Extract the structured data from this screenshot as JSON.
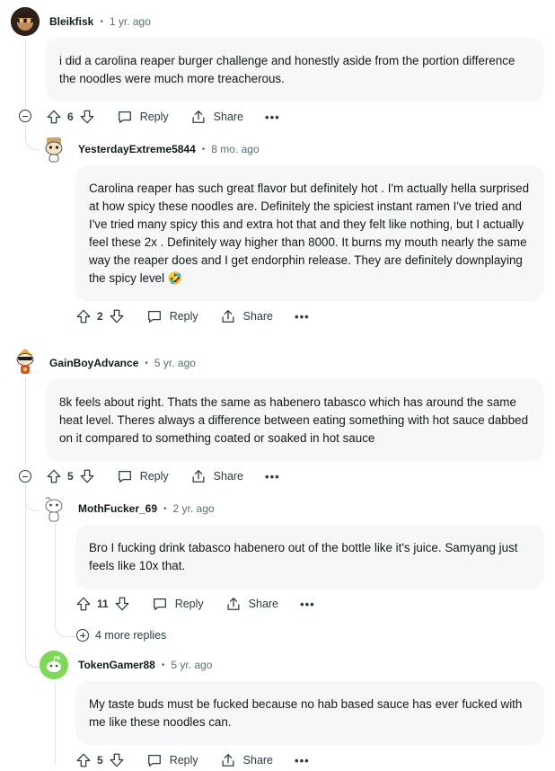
{
  "comments": [
    {
      "user": "Bleikfisk",
      "time": "1 yr. ago",
      "avatar": "dark-photo-avatar",
      "text": "i did a carolina reaper burger challenge and honestly aside from the portion difference the noodles were much more treacherous.",
      "votes": "6",
      "reply_label": "Reply",
      "share_label": "Share"
    },
    {
      "user": "YesterdayExtreme5844",
      "time": "8 mo. ago",
      "avatar": "snoo-cartoon-avatar",
      "text": "Carolina reaper has such great flavor but definitely hot . I'm actually hella surprised at how spicy these noodles are. Definitely the spiciest instant ramen I've tried and I've tried many spicy this and extra hot that and they felt like nothing, but I actually feel these 2x . Definitely way higher than 8000. It burns my mouth nearly the same way the reaper does and I get endorphin release. They are definitely downplaying the spicy level",
      "emoji": "🤣",
      "votes": "2",
      "reply_label": "Reply",
      "share_label": "Share"
    },
    {
      "user": "GainBoyAdvance",
      "time": "5 yr. ago",
      "avatar": "snoo-cartoon-avatar",
      "text": "8k feels about right. Thats the same as habenero tabasco which has around the same heat level. Theres always a difference between eating something with hot sauce dabbed on it compared to something coated or soaked in hot sauce",
      "votes": "5",
      "reply_label": "Reply",
      "share_label": "Share"
    },
    {
      "user": "MothFucker_69",
      "time": "2 yr. ago",
      "avatar": "snoo-outline-avatar",
      "text": "Bro I fucking drink tabasco habenero out of the bottle like it's juice. Samyang just feels like 10x that.",
      "votes": "11",
      "reply_label": "Reply",
      "share_label": "Share",
      "more_replies": "4 more replies"
    },
    {
      "user": "TokenGamer88",
      "time": "5 yr. ago",
      "avatar": "snoo-green-avatar",
      "text": "My taste buds must be fucked because no hab based sauce has ever fucked with me like these noodles can.",
      "votes": "5",
      "reply_label": "Reply",
      "share_label": "Share"
    }
  ],
  "separator": "•",
  "more_label": "•••",
  "colors": {
    "bubble_bg": "#f6f7f8",
    "thread_line": "#dfe3e5",
    "meta_text": "#576f76",
    "green_avatar": "#7ed957"
  }
}
